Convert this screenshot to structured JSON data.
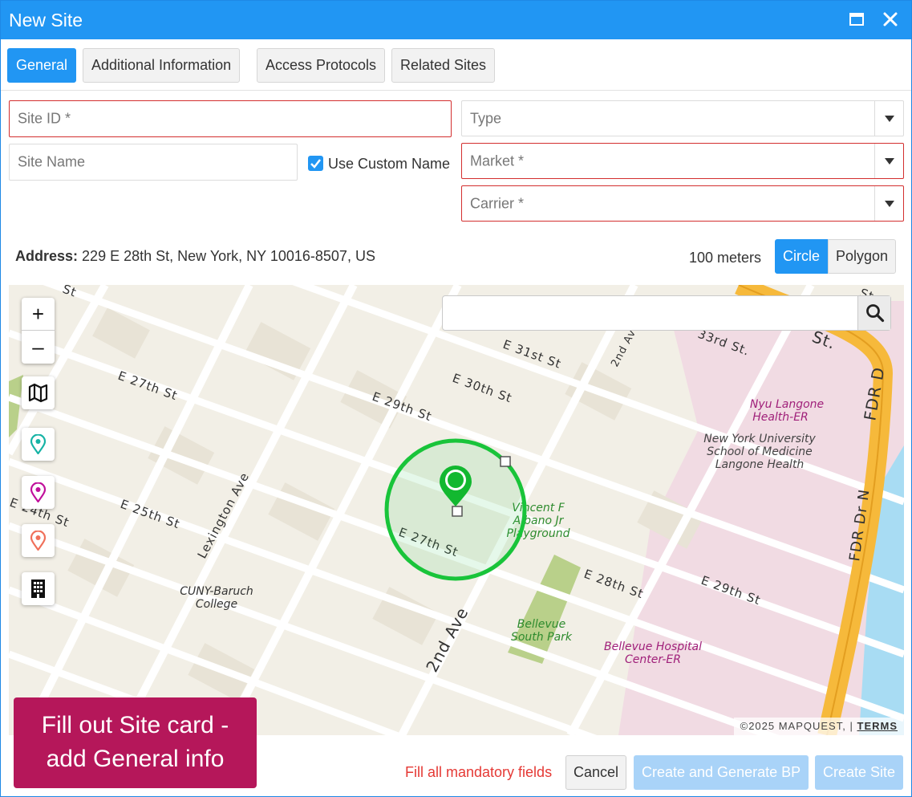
{
  "window": {
    "title": "New Site"
  },
  "tabs": [
    {
      "label": "General",
      "active": true
    },
    {
      "label": "Additional Information",
      "active": false
    },
    {
      "label": "Access Protocols",
      "active": false
    },
    {
      "label": "Related Sites",
      "active": false
    }
  ],
  "form": {
    "site_id_placeholder": "Site ID *",
    "site_name_placeholder": "Site Name",
    "use_custom_name_label": "Use Custom Name",
    "use_custom_name_checked": true,
    "type_placeholder": "Type",
    "market_placeholder": "Market *",
    "carrier_placeholder": "Carrier *"
  },
  "address": {
    "label": "Address:",
    "value": "229 E 28th St, New York, NY 10016-8507, US"
  },
  "geofence": {
    "radius": "100 meters",
    "circle_label": "Circle",
    "polygon_label": "Polygon",
    "mode": "Circle"
  },
  "map": {
    "zoom_in": "+",
    "zoom_out": "–",
    "search_value": "",
    "copyright": "©2025 MAPQUEST,",
    "separator": "|",
    "terms": "TERMS",
    "streets": {
      "e31": "E 31st St",
      "e30": "E 30th St",
      "e29": "E 29th St",
      "e28": "E 28th St",
      "e27a": "E 27th St",
      "e27b": "E 27th St",
      "e25": "E 25th St",
      "e24": "E 24th St",
      "e33": "33rd St.",
      "e29b": "E 29th St",
      "e28b": "E 28th St",
      "lex": "Lexington Ave",
      "second": "2nd Ave",
      "fdr": "FDR D",
      "fdrn": "FDR Dr N",
      "st1": "St",
      "st2": "St",
      "st3": "St."
    },
    "places": {
      "nyu_langone_1": "Nyu Langone",
      "nyu_langone_2": "Health-ER",
      "nyu_med_1": "New York University",
      "nyu_med_2": "School of Medicine",
      "nyu_med_3": "Langone Health",
      "vincent_1": "Vincent F",
      "vincent_2": "Albano Jr",
      "vincent_3": "Playground",
      "cuny_1": "CUNY-Baruch",
      "cuny_2": "College",
      "bellevue_park_1": "Bellevue",
      "bellevue_park_2": "South Park",
      "bellevue_hosp_1": "Bellevue Hospital",
      "bellevue_hosp_2": "Center-ER"
    },
    "colors": {
      "land": "#f2efe6",
      "road": "#ffffff",
      "highway": "#f6b93b",
      "water": "#a8dcf3",
      "park": "#b9d08a",
      "hospital": "#f1dbe3",
      "geofence": "#19c43a"
    }
  },
  "callout": {
    "line1": "Fill out Site card -",
    "line2": "add General info"
  },
  "footer": {
    "error": "Fill all mandatory fields",
    "cancel": "Cancel",
    "create_and_generate": "Create and Generate BP",
    "create_site": "Create Site"
  }
}
